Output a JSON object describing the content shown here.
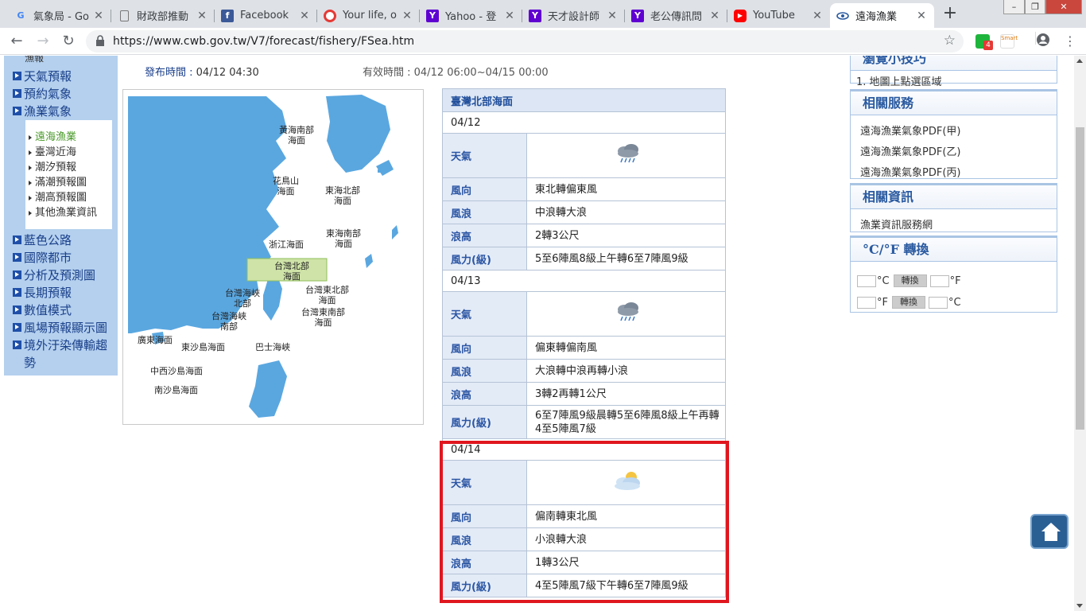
{
  "browser": {
    "tabs": [
      {
        "title": "氣象局 - Go",
        "icon": "google-g-icon",
        "icon_text": "G",
        "active": false
      },
      {
        "title": "財政部推動",
        "icon": "document-icon",
        "icon_text": "",
        "active": false
      },
      {
        "title": "Facebook",
        "icon": "facebook-icon",
        "icon_text": "f",
        "active": false
      },
      {
        "title": "Your life, o",
        "icon": "red-app-icon",
        "icon_text": "",
        "active": false
      },
      {
        "title": "Yahoo - 登",
        "icon": "yahoo-icon",
        "icon_text": "Y",
        "active": false
      },
      {
        "title": "天才設計師",
        "icon": "yahoo-icon",
        "icon_text": "Y",
        "active": false
      },
      {
        "title": "老公傳訊問",
        "icon": "yahoo-icon",
        "icon_text": "Y",
        "active": false
      },
      {
        "title": "YouTube",
        "icon": "youtube-icon",
        "icon_text": "▶",
        "active": false
      },
      {
        "title": "遠海漁業",
        "icon": "cwb-eye-icon",
        "icon_text": "",
        "active": true
      }
    ],
    "new_tab": "+",
    "url": "https://www.cwb.gov.tw/V7/forecast/fishery/FSea.htm",
    "ext_badge": "4",
    "ext_smart_label": "Smart"
  },
  "leftnav": {
    "top_cut_label": "漁報",
    "items": [
      "天氣預報",
      "預約氣象",
      "漁業氣象",
      "藍色公路",
      "國際都市",
      "分析及預測圖",
      "長期預報",
      "數值模式",
      "風場預報顯示圖",
      "境外汙染傳輸趨勢"
    ],
    "subitems": [
      "遠海漁業",
      "臺灣近海",
      "潮汐預報",
      "滿潮預報圖",
      "潮高預報圖",
      "其他漁業資訊"
    ]
  },
  "header": {
    "pub_label": "發布時間 : ",
    "pub_value": "04/12 04:30",
    "valid_text": "有效時間 : 04/12 06:00~04/15 00:00"
  },
  "map": {
    "labels": [
      "黃海南部\n海面",
      "花鳥山\n海面",
      "東海北部\n海面",
      "東海南部\n海面",
      "浙江海面",
      "台灣北部\n海面",
      "台灣海峽\n北部",
      "台灣東北部\n海面",
      "台灣東南部\n海面",
      "台灣海峽\n南部",
      "廣東海面",
      "東沙島海面",
      "巴士海峽",
      "中西沙島海面",
      "南沙島海面"
    ]
  },
  "forecast": {
    "region": "臺灣北部海面",
    "row_labels": {
      "weather": "天氣",
      "wind_dir": "風向",
      "wave": "風浪",
      "wave_height": "浪高",
      "wind_force": "風力(級)"
    },
    "days": [
      {
        "date": "04/12",
        "weather_icon": "cloud-rain-icon",
        "wind_dir": "東北轉偏東風",
        "wave": "中浪轉大浪",
        "wave_height": "2轉3公尺",
        "wind_force": "5至6陣風8級上午轉6至7陣風9級"
      },
      {
        "date": "04/13",
        "weather_icon": "cloud-rain-icon",
        "wind_dir": "偏東轉偏南風",
        "wave": "大浪轉中浪再轉小浪",
        "wave_height": "3轉2再轉1公尺",
        "wind_force": "6至7陣風9級晨轉5至6陣風8級上午再轉4至5陣風7級"
      },
      {
        "date": "04/14",
        "weather_icon": "partly-cloudy-icon",
        "wind_dir": "偏南轉東北風",
        "wave": "小浪轉大浪",
        "wave_height": "1轉3公尺",
        "wind_force": "4至5陣風7級下午轉6至7陣風9級"
      }
    ]
  },
  "right": {
    "tip_title": "瀏覽小技巧",
    "tip_text": "1. 地圖上點選區域",
    "services_title": "相關服務",
    "services": [
      "遠海漁業氣象PDF(甲)",
      "遠海漁業氣象PDF(乙)",
      "遠海漁業氣象PDF(丙)"
    ],
    "info_title": "相關資訊",
    "info_links": [
      "漁業資訊服務網"
    ],
    "conv_title": "°C/°F 轉換",
    "conv_btn": "轉換",
    "unit_c": "°C",
    "unit_f": "°F"
  },
  "colors": {
    "highlight": "#e0161e",
    "nav_bg": "#b4d0ee",
    "link_blue": "#1a3f8a"
  }
}
